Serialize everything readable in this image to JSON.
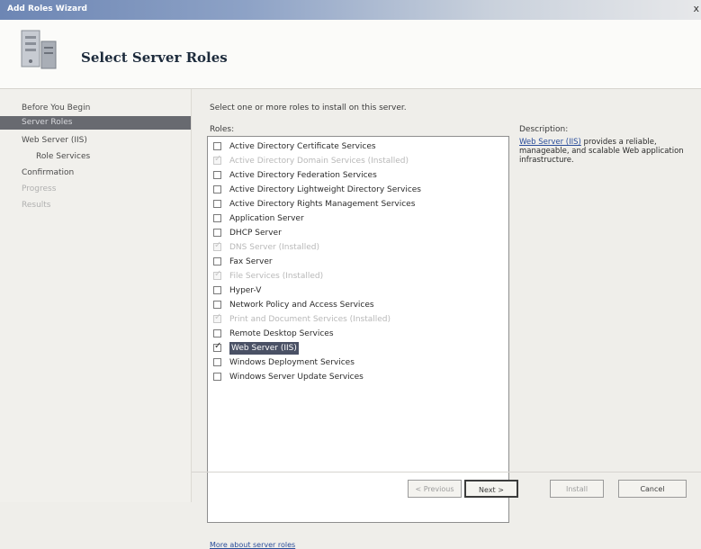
{
  "window": {
    "title": "Add Roles Wizard",
    "close_glyph": "x"
  },
  "header": {
    "page_title": "Select Server Roles",
    "icon": "server-roles-icon"
  },
  "nav": {
    "items": [
      {
        "label": "Before You Begin",
        "state": "normal"
      },
      {
        "label": "Server Roles",
        "state": "active"
      },
      {
        "label": "Web Server (IIS)",
        "state": "normal"
      },
      {
        "label": "Role Services",
        "state": "sub"
      },
      {
        "label": "Confirmation",
        "state": "normal"
      },
      {
        "label": "Progress",
        "state": "disabled"
      },
      {
        "label": "Results",
        "state": "disabled"
      }
    ]
  },
  "content": {
    "instruction": "Select one or more roles to install on this server.",
    "roles_label": "Roles:",
    "roles": [
      {
        "label": "Active Directory Certificate Services",
        "checked": false,
        "installed": false
      },
      {
        "label": "Active Directory Domain Services  (Installed)",
        "checked": true,
        "installed": true
      },
      {
        "label": "Active Directory Federation Services",
        "checked": false,
        "installed": false
      },
      {
        "label": "Active Directory Lightweight Directory Services",
        "checked": false,
        "installed": false
      },
      {
        "label": "Active Directory Rights Management Services",
        "checked": false,
        "installed": false
      },
      {
        "label": "Application Server",
        "checked": false,
        "installed": false
      },
      {
        "label": "DHCP Server",
        "checked": false,
        "installed": false
      },
      {
        "label": "DNS Server  (Installed)",
        "checked": true,
        "installed": true
      },
      {
        "label": "Fax Server",
        "checked": false,
        "installed": false
      },
      {
        "label": "File Services  (Installed)",
        "checked": true,
        "installed": true
      },
      {
        "label": "Hyper-V",
        "checked": false,
        "installed": false
      },
      {
        "label": "Network Policy and Access Services",
        "checked": false,
        "installed": false
      },
      {
        "label": "Print and Document Services  (Installed)",
        "checked": true,
        "installed": true
      },
      {
        "label": "Remote Desktop Services",
        "checked": false,
        "installed": false
      },
      {
        "label": "Web Server (IIS)",
        "checked": true,
        "installed": false,
        "selected": true
      },
      {
        "label": "Windows Deployment Services",
        "checked": false,
        "installed": false
      },
      {
        "label": "Windows Server Update Services",
        "checked": false,
        "installed": false
      }
    ],
    "more_link": "More about server roles",
    "description_label": "Description:",
    "description_link": "Web Server (IIS)",
    "description_rest": " provides a reliable, manageable, and scalable Web application infrastructure."
  },
  "buttons": {
    "previous": "< Previous",
    "next": "Next >",
    "install": "Install",
    "cancel": "Cancel"
  }
}
